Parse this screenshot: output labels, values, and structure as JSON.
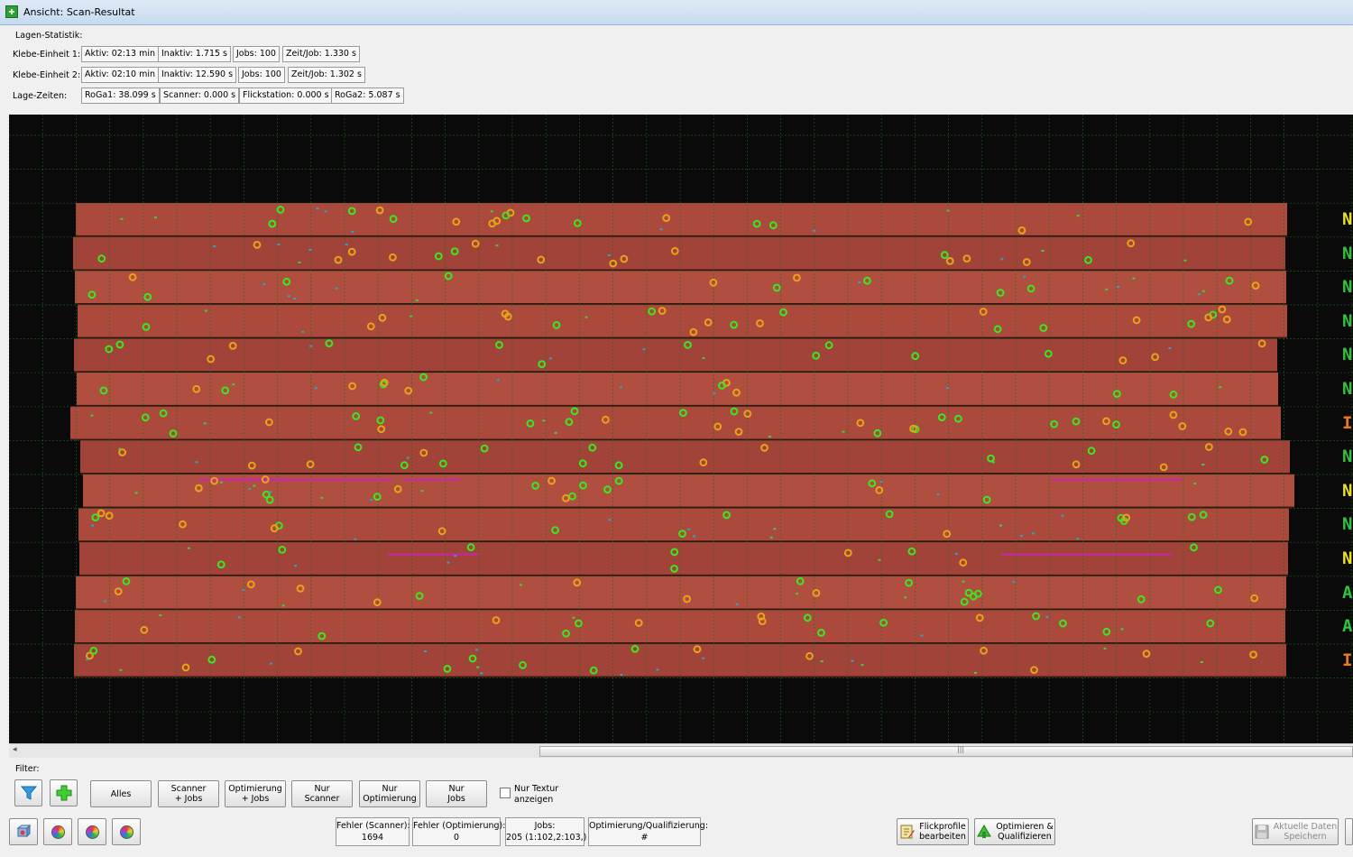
{
  "window": {
    "title": "Ansicht: Scan-Resultat"
  },
  "stats": {
    "title": "Lagen-Statistik:",
    "rows": [
      {
        "label": "Klebe-Einheit 1:",
        "values": [
          "Aktiv: 02:13 min",
          "Inaktiv: 1.715 s",
          "Jobs: 100",
          "Zeit/Job: 1.330 s"
        ]
      },
      {
        "label": "Klebe-Einheit 2:",
        "values": [
          "Aktiv: 02:10 min",
          "Inaktiv: 12.590 s",
          "Jobs: 100",
          "Zeit/Job: 1.302 s"
        ]
      },
      {
        "label": "Lage-Zeiten:",
        "values": [
          "RoGa1: 38.099 s",
          "Scanner: 0.000 s",
          "Flickstation: 0.000 s",
          "RoGa2: 5.087 s"
        ]
      }
    ]
  },
  "board_status": [
    {
      "letter": "N",
      "color": "#e8e020"
    },
    {
      "letter": "N",
      "color": "#2fc43a"
    },
    {
      "letter": "N",
      "color": "#2fc43a"
    },
    {
      "letter": "N",
      "color": "#2fc43a"
    },
    {
      "letter": "N",
      "color": "#2fc43a"
    },
    {
      "letter": "N",
      "color": "#2fc43a"
    },
    {
      "letter": "I",
      "color": "#ee7a1e"
    },
    {
      "letter": "N",
      "color": "#2fc43a"
    },
    {
      "letter": "N",
      "color": "#e8e020"
    },
    {
      "letter": "N",
      "color": "#2fc43a"
    },
    {
      "letter": "N",
      "color": "#e8e020"
    },
    {
      "letter": "A",
      "color": "#2fc43a"
    },
    {
      "letter": "A",
      "color": "#2fc43a"
    },
    {
      "letter": "I",
      "color": "#ee7a1e"
    }
  ],
  "colors": {
    "wood": "#a8473a",
    "marker_green": "#39e81f",
    "marker_orange": "#e8a318",
    "marker_pink": "#d21fc3",
    "grid": "#1f6b1f"
  },
  "filter": {
    "label": "Filter:",
    "buttons": [
      "Alles",
      "Scanner\n+ Jobs",
      "Optimierung\n+ Jobs",
      "Nur\nScanner",
      "Nur\nOptimierung",
      "Nur\nJobs"
    ],
    "texture_checkbox": "Nur Textur\nanzeigen"
  },
  "info": {
    "fehler_scanner": {
      "label": "Fehler (Scanner):",
      "value": "1694"
    },
    "fehler_optimierung": {
      "label": "Fehler (Optimierung):",
      "value": "0"
    },
    "jobs": {
      "label": "Jobs:",
      "value": "205 (1:102,2:103,)"
    },
    "opt_qual": {
      "label": "Optimierung/Qualifizierung:",
      "value": "#"
    }
  },
  "actions": {
    "flickprofile": "Flickprofile\nbearbeiten",
    "optimize": "Optimieren &\nQualifizieren",
    "save": "Aktuelle Daten\nSpeichern"
  },
  "icons": [
    "app-icon",
    "funnel-icon",
    "plus-icon",
    "3d-view-icon",
    "color-wheel-icon",
    "edit-icon",
    "optimize-icon",
    "save-icon"
  ]
}
